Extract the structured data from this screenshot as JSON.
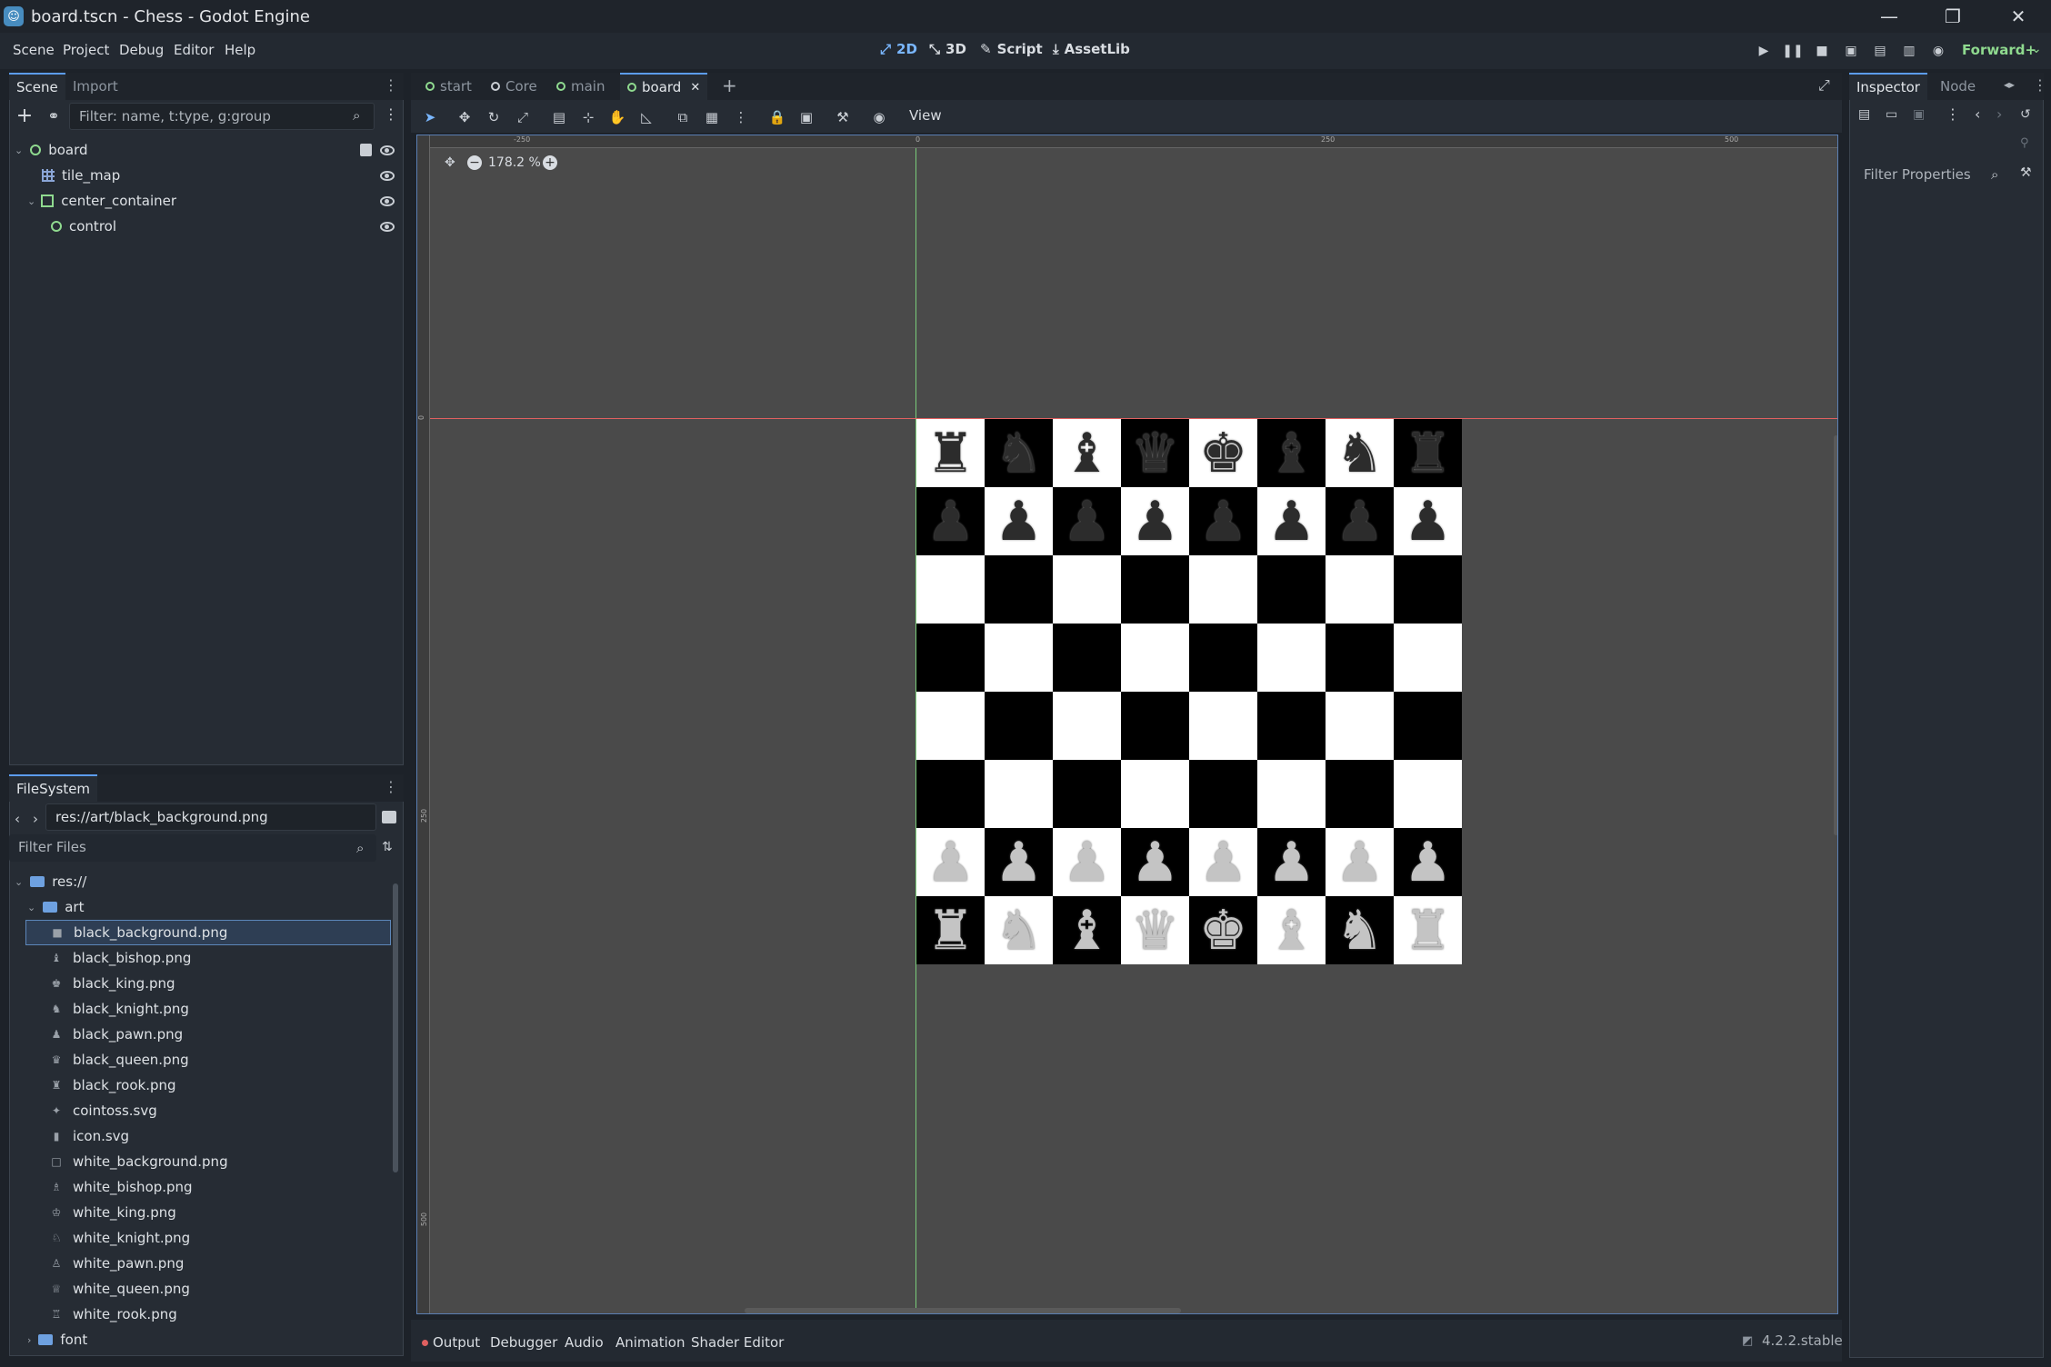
{
  "window": {
    "title": "board.tscn - Chess - Godot Engine",
    "minimize_glyph": "—",
    "maximize_glyph": "❐",
    "close_glyph": "✕"
  },
  "menubar": {
    "menus": [
      "Scene",
      "Project",
      "Debug",
      "Editor",
      "Help"
    ],
    "workspaces": [
      {
        "label": "2D",
        "icon": "2d-icon",
        "glyph": "⤢",
        "active": true
      },
      {
        "label": "3D",
        "icon": "3d-icon",
        "glyph": "⤡",
        "active": false
      },
      {
        "label": "Script",
        "icon": "script-icon",
        "glyph": "✎",
        "active": false
      },
      {
        "label": "AssetLib",
        "icon": "download-icon",
        "glyph": "⤓",
        "active": false
      }
    ],
    "renderer": "Forward+"
  },
  "scene_dock": {
    "tabs": [
      "Scene",
      "Import"
    ],
    "filter_placeholder": "Filter: name, t:type, g:group",
    "nodes": [
      {
        "label": "board",
        "depth": 0,
        "icon": "node2d-icon"
      },
      {
        "label": "tile_map",
        "depth": 1,
        "icon": "tilemap-icon"
      },
      {
        "label": "center_container",
        "depth": 1,
        "icon": "container-icon"
      },
      {
        "label": "control",
        "depth": 2,
        "icon": "control-icon"
      }
    ]
  },
  "filesystem": {
    "title": "FileSystem",
    "path": "res://art/black_background.png",
    "filter_placeholder": "Filter Files",
    "root": "res://",
    "folder": "art",
    "files": [
      {
        "name": "black_background.png",
        "selected": true,
        "icon": "■"
      },
      {
        "name": "black_bishop.png",
        "selected": false,
        "icon": "♝"
      },
      {
        "name": "black_king.png",
        "selected": false,
        "icon": "♚"
      },
      {
        "name": "black_knight.png",
        "selected": false,
        "icon": "♞"
      },
      {
        "name": "black_pawn.png",
        "selected": false,
        "icon": "♟"
      },
      {
        "name": "black_queen.png",
        "selected": false,
        "icon": "♛"
      },
      {
        "name": "black_rook.png",
        "selected": false,
        "icon": "♜"
      },
      {
        "name": "cointoss.svg",
        "selected": false,
        "icon": "✦"
      },
      {
        "name": "icon.svg",
        "selected": false,
        "icon": "▮"
      },
      {
        "name": "white_background.png",
        "selected": false,
        "icon": "□"
      },
      {
        "name": "white_bishop.png",
        "selected": false,
        "icon": "♗"
      },
      {
        "name": "white_king.png",
        "selected": false,
        "icon": "♔"
      },
      {
        "name": "white_knight.png",
        "selected": false,
        "icon": "♘"
      },
      {
        "name": "white_pawn.png",
        "selected": false,
        "icon": "♙"
      },
      {
        "name": "white_queen.png",
        "selected": false,
        "icon": "♕"
      },
      {
        "name": "white_rook.png",
        "selected": false,
        "icon": "♖"
      }
    ],
    "subfolder": "font"
  },
  "editor_tabs": [
    {
      "label": "start",
      "active": false
    },
    {
      "label": "Core",
      "active": false
    },
    {
      "label": "main",
      "active": false
    },
    {
      "label": "board",
      "active": true
    }
  ],
  "toolbar": {
    "view_label": "View",
    "zoom": "178.2 %"
  },
  "rulers": {
    "top": [
      "-250",
      "0",
      "250",
      "500"
    ],
    "left": [
      "0",
      "250",
      "500"
    ]
  },
  "board": {
    "top_row": [
      "♜",
      "♞",
      "♝",
      "♛",
      "♚",
      "♝",
      "♞",
      "♜"
    ],
    "pawn": "♟",
    "white_pawn": "♟",
    "bottom_row": [
      "♜",
      "♞",
      "♝",
      "♛",
      "♚",
      "♝",
      "♞",
      "♜"
    ]
  },
  "bottom_panel": {
    "tabs": [
      "Output",
      "Debugger",
      "Audio",
      "Animation",
      "Shader Editor"
    ],
    "version": "4.2.2.stable"
  },
  "inspector": {
    "tabs": [
      "Inspector",
      "Node"
    ],
    "filter_placeholder": "Filter Properties"
  },
  "colors": {
    "accent": "#5c9cf0",
    "node_green": "#8fda8f",
    "viewport_bg": "#4a4a4a",
    "x_axis": "#e06060",
    "y_axis": "#7acc7a"
  }
}
